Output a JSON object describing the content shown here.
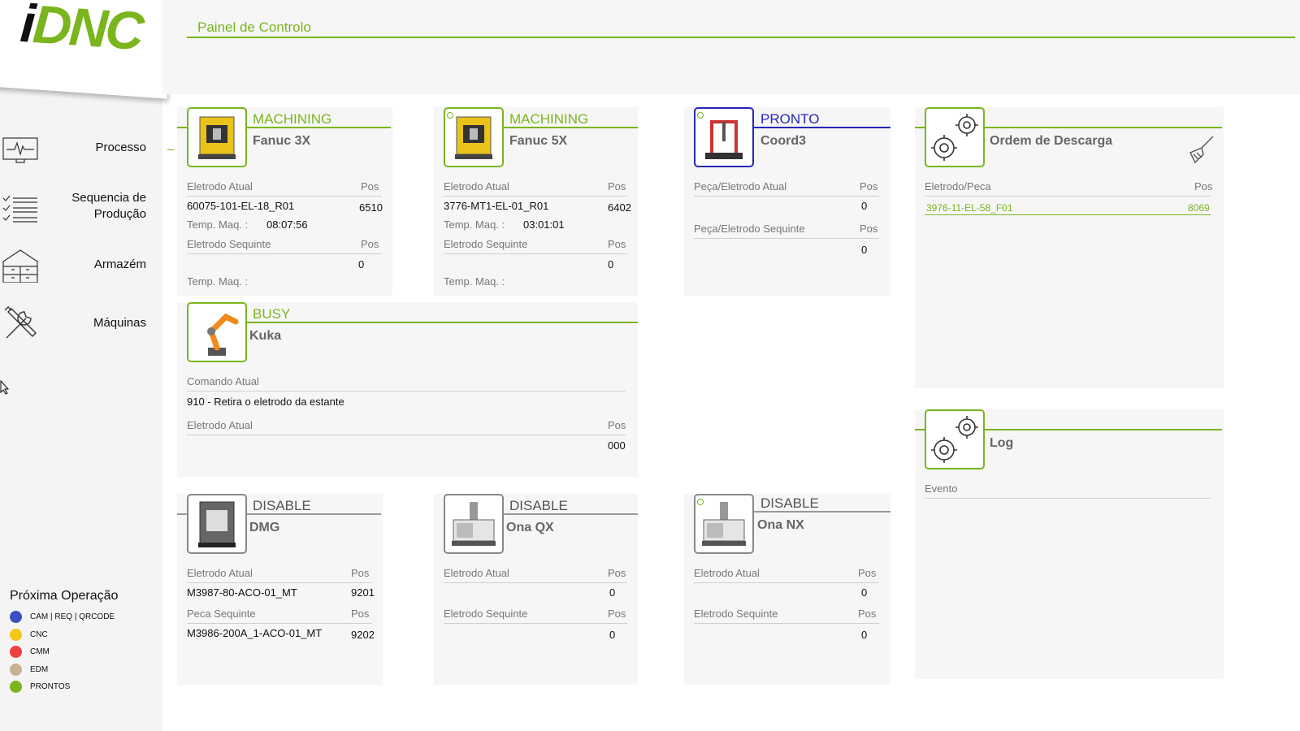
{
  "app": {
    "logo_i": "i",
    "logo_dnc": "DNC"
  },
  "header": {
    "title": "Painel de Controlo"
  },
  "sidebar": {
    "items": [
      {
        "label": "Processo",
        "icon": "monitor-pulse-icon"
      },
      {
        "label": "Sequencia de\nProdução",
        "icon": "checklist-icon"
      },
      {
        "label": "Armazém",
        "icon": "warehouse-icon"
      },
      {
        "label": "Máquinas",
        "icon": "tools-icon"
      }
    ]
  },
  "legend": {
    "title": "Próxima Operação",
    "items": [
      {
        "label": "CAM | REQ | QRCODE",
        "color": "#3a4fc4"
      },
      {
        "label": "CNC",
        "color": "#f5c518"
      },
      {
        "label": "CMM",
        "color": "#ee4040"
      },
      {
        "label": "EDM",
        "color": "#c8b090"
      },
      {
        "label": "PRONTOS",
        "color": "#7ab51d"
      }
    ]
  },
  "cards": {
    "fanuc3x": {
      "status": "MACHINING",
      "name": "Fanuc 3X",
      "current_label": "Eletrodo Atual",
      "pos_label": "Pos",
      "current_value": "60075-101-EL-18_R01",
      "current_pos": "6510",
      "temp_label": "Temp. Maq. :",
      "temp_value": "08:07:56",
      "next_label": "Eletrodo Sequinte",
      "next_pos_label": "Pos",
      "next_pos": "0",
      "temp2_label": "Temp. Maq. :"
    },
    "fanuc5x": {
      "status": "MACHINING",
      "name": "Fanuc 5X",
      "current_label": "Eletrodo Atual",
      "pos_label": "Pos",
      "current_value": "3776-MT1-EL-01_R01",
      "current_pos": "6402",
      "temp_label": "Temp. Maq. :",
      "temp_value": "03:01:01",
      "next_label": "Eletrodo Sequinte",
      "next_pos_label": "Pos",
      "next_pos": "0",
      "temp2_label": "Temp. Maq. :"
    },
    "coord3": {
      "status": "PRONTO",
      "name": "Coord3",
      "current_label": "Peça/Eletrodo Atual",
      "pos_label": "Pos",
      "current_pos": "0",
      "next_label": "Peça/Eletrodo Sequinte",
      "next_pos_label": "Pos",
      "next_pos": "0"
    },
    "descarga": {
      "name": "Ordem de Descarga",
      "col_label": "Eletrodo/Peca",
      "pos_label": "Pos",
      "row_value": "3976-11-EL-58_F01",
      "row_pos": "8069"
    },
    "kuka": {
      "status": "BUSY",
      "name": "Kuka",
      "cmd_label": "Comando Atual",
      "cmd_value": "910 - Retira o eletrodo da estante",
      "current_label": "Eletrodo Atual",
      "pos_label": "Pos",
      "current_pos": "000"
    },
    "log": {
      "name": "Log",
      "event_label": "Evento"
    },
    "dmg": {
      "status": "DISABLE",
      "name": "DMG",
      "current_label": "Eletrodo Atual",
      "pos_label": "Pos",
      "current_value": "M3987-80-ACO-01_MT",
      "current_pos": "9201",
      "next_label": "Peca Sequinte",
      "next_pos_label": "Pos",
      "next_value": "M3986-200A_1-ACO-01_MT",
      "next_pos": "9202"
    },
    "onaqx": {
      "status": "DISABLE",
      "name": "Ona QX",
      "current_label": "Eletrodo Atual",
      "pos_label": "Pos",
      "current_pos": "0",
      "next_label": "Eletrodo Sequinte",
      "next_pos_label": "Pos",
      "next_pos": "0"
    },
    "onanx": {
      "status": "DISABLE",
      "name": "Ona NX",
      "current_label": "Eletrodo Atual",
      "pos_label": "Pos",
      "current_pos": "0",
      "next_label": "Eletrodo Sequinte",
      "next_pos_label": "Pos",
      "next_pos": "0"
    }
  }
}
